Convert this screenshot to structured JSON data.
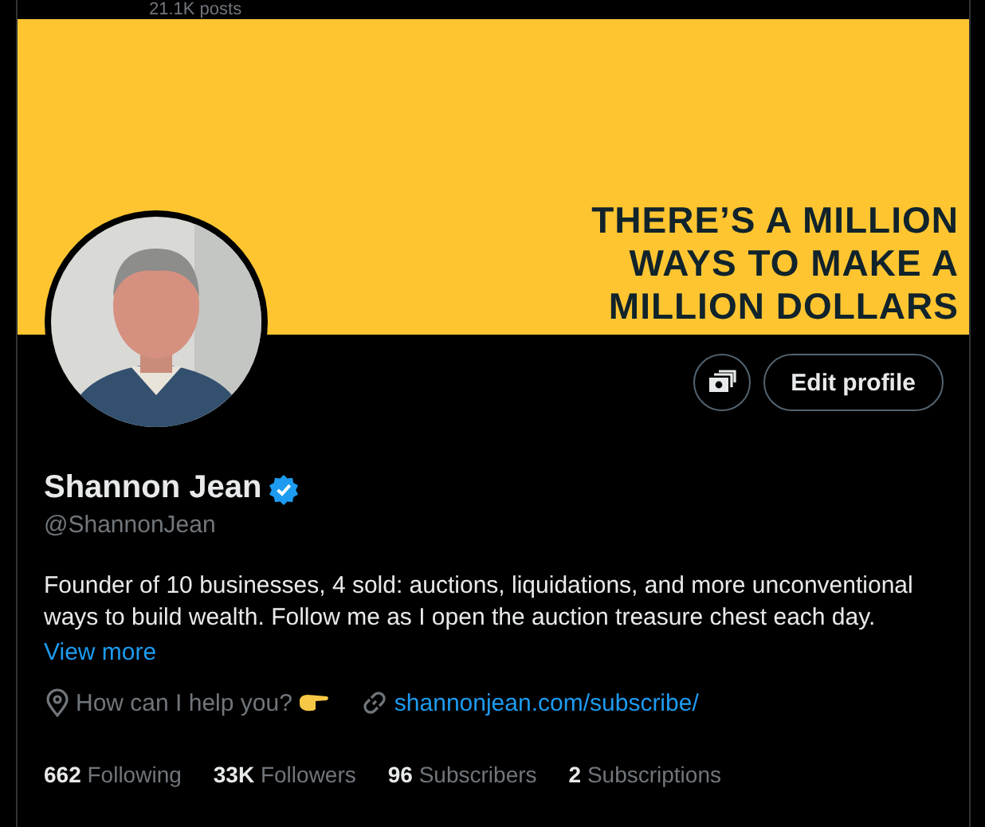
{
  "header": {
    "post_count": "21.1K posts"
  },
  "banner": {
    "lines": [
      "THERE’S A MILLION",
      "WAYS TO MAKE A",
      "MILLION DOLLARS"
    ]
  },
  "actions": {
    "edit_button": "Edit profile"
  },
  "profile": {
    "name": "Shannon Jean",
    "verified": true,
    "handle": "@ShannonJean",
    "bio": "Founder of 10 businesses, 4 sold: auctions, liquidations, and more unconventional ways to build wealth. Follow me as I open the auction treasure chest each day.",
    "view_more": "View more",
    "location": "How can I help you?",
    "website": "shannonjean.com/subscribe/"
  },
  "stats": [
    {
      "count": "662",
      "label": "Following"
    },
    {
      "count": "33K",
      "label": "Followers"
    },
    {
      "count": "96",
      "label": "Subscribers"
    },
    {
      "count": "2",
      "label": "Subscriptions"
    }
  ]
}
